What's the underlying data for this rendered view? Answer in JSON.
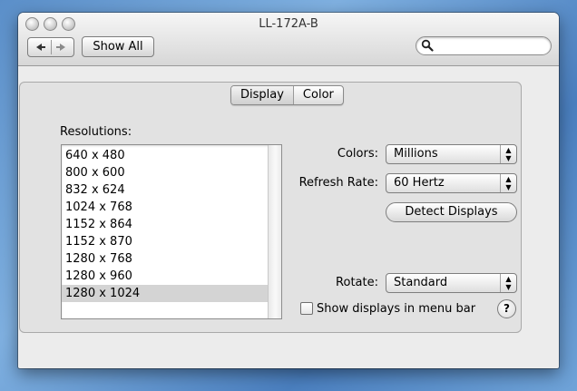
{
  "window": {
    "title": "LL-172A-B"
  },
  "toolbar": {
    "show_all_label": "Show All",
    "search_placeholder": "",
    "search_value": ""
  },
  "tabs": [
    {
      "label": "Display",
      "selected": true
    },
    {
      "label": "Color",
      "selected": false
    }
  ],
  "resolutions": {
    "label": "Resolutions:",
    "items": [
      "640 x 480",
      "800 x 600",
      "832 x 624",
      "1024 x 768",
      "1152 x 864",
      "1152 x 870",
      "1280 x 768",
      "1280 x 960",
      "1280 x 1024"
    ],
    "selected": "1280 x 1024"
  },
  "colors": {
    "label": "Colors:",
    "value": "Millions"
  },
  "refresh": {
    "label": "Refresh Rate:",
    "value": "60 Hertz"
  },
  "detect_label": "Detect Displays",
  "rotate": {
    "label": "Rotate:",
    "value": "Standard"
  },
  "menu_bar_checkbox": {
    "label": "Show displays in menu bar",
    "checked": false
  },
  "help_label": "?",
  "icons": {
    "close": "traffic-light-close-icon",
    "minimize": "traffic-light-minimize-icon",
    "zoom": "traffic-light-zoom-icon",
    "back": "back-arrow-icon",
    "forward": "forward-arrow-icon",
    "search": "magnifier-icon",
    "popup": "up-down-arrows-icon"
  }
}
